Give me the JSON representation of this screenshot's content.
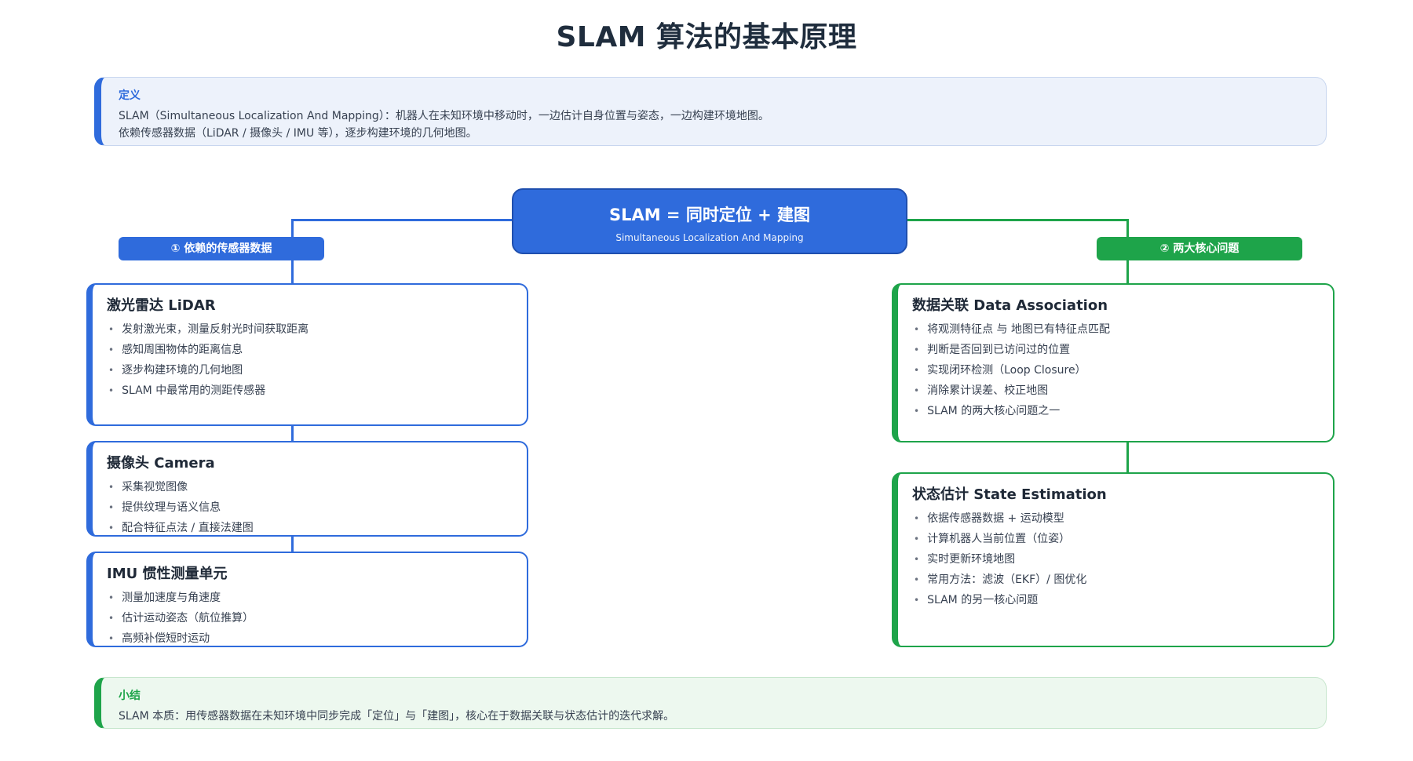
{
  "title": "SLAM 算法的基本原理",
  "definition": {
    "heading": "定义",
    "lines": [
      "SLAM（Simultaneous Localization And Mapping）：机器人在未知环境中移动时，一边估计自身位置与姿态，一边构建环境地图。",
      "依赖传感器数据（LiDAR / 摄像头 / IMU 等），逐步构建环境的几何地图。"
    ]
  },
  "center": {
    "title": "SLAM = 同时定位 + 建图",
    "subtitle": "Simultaneous Localization And Mapping"
  },
  "left_branch": {
    "label": "① 依赖的传感器数据",
    "cards": [
      {
        "title": "激光雷达 LiDAR",
        "items": [
          "发射激光束，测量反射光时间获取距离",
          "感知周围物体的距离信息",
          "逐步构建环境的几何地图",
          "SLAM 中最常用的测距传感器"
        ]
      },
      {
        "title": "摄像头 Camera",
        "items": [
          "采集视觉图像",
          "提供纹理与语义信息",
          "配合特征点法 / 直接法建图"
        ]
      },
      {
        "title": "IMU 惯性测量单元",
        "items": [
          "测量加速度与角速度",
          "估计运动姿态（航位推算）",
          "高频补偿短时运动"
        ]
      }
    ]
  },
  "right_branch": {
    "label": "② 两大核心问题",
    "cards": [
      {
        "title": "数据关联 Data Association",
        "items": [
          "将观测特征点 与 地图已有特征点匹配",
          "判断是否回到已访问过的位置",
          "实现闭环检测（Loop Closure）",
          "消除累计误差、校正地图",
          "SLAM 的两大核心问题之一"
        ]
      },
      {
        "title": "状态估计 State Estimation",
        "items": [
          "依据传感器数据 + 运动模型",
          "计算机器人当前位置（位姿）",
          "实时更新环境地图",
          "常用方法：滤波（EKF）/ 图优化",
          "SLAM 的另一核心问题"
        ]
      }
    ]
  },
  "summary": {
    "heading": "小结",
    "lines": [
      "SLAM 本质：用传感器数据在未知环境中同步完成「定位」与「建图」，核心在于数据关联与状态估计的迭代求解。"
    ]
  },
  "colors": {
    "blue": "#2f6bdc",
    "green": "#1ea44a"
  }
}
